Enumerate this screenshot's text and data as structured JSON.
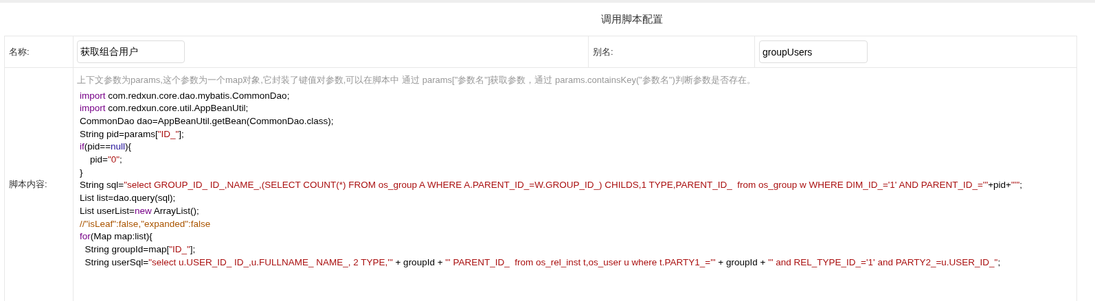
{
  "title": "调用脚本配置",
  "name_label": "名称:",
  "name_value": "获取组合用户",
  "alias_label": "别名:",
  "alias_value": "groupUsers",
  "script_label": "脚本内容:",
  "script_hint": "上下文参数为params,这个参数为一个map对象,它封装了键值对参数,可以在脚本中 通过 params[\"参数名\"]获取参数，通过 params.containsKey(\"参数名\")判断参数是否存在。",
  "code_lines": [
    [
      {
        "kind": "keyword",
        "text": "import"
      },
      {
        "kind": "plain",
        "text": " com.redxun.core.dao.mybatis.CommonDao;"
      }
    ],
    [
      {
        "kind": "keyword",
        "text": "import"
      },
      {
        "kind": "plain",
        "text": " com.redxun.core.util.AppBeanUtil;"
      }
    ],
    [
      {
        "kind": "plain",
        "text": "CommonDao dao=AppBeanUtil.getBean(CommonDao.class);"
      }
    ],
    [
      {
        "kind": "plain",
        "text": "String pid=params["
      },
      {
        "kind": "string",
        "text": "\"ID_\""
      },
      {
        "kind": "plain",
        "text": "];"
      }
    ],
    [
      {
        "kind": "keyword",
        "text": "if"
      },
      {
        "kind": "plain",
        "text": "(pid=="
      },
      {
        "kind": "atom",
        "text": "null"
      },
      {
        "kind": "plain",
        "text": "){"
      }
    ],
    [
      {
        "kind": "plain",
        "text": "    pid="
      },
      {
        "kind": "string",
        "text": "\"0\""
      },
      {
        "kind": "plain",
        "text": ";"
      }
    ],
    [
      {
        "kind": "plain",
        "text": "}"
      }
    ],
    [
      {
        "kind": "plain",
        "text": "String sql="
      },
      {
        "kind": "string",
        "text": "\"select GROUP_ID_ ID_,NAME_,(SELECT COUNT(*) FROM os_group A WHERE A.PARENT_ID_=W.GROUP_ID_) CHILDS,1 TYPE,PARENT_ID_  from os_group w WHERE DIM_ID_='1' AND PARENT_ID_='\""
      },
      {
        "kind": "plain",
        "text": "+pid+"
      },
      {
        "kind": "string",
        "text": "\"'\""
      },
      {
        "kind": "plain",
        "text": ";"
      }
    ],
    [
      {
        "kind": "plain",
        "text": "List list=dao.query(sql);"
      }
    ],
    [
      {
        "kind": "plain",
        "text": "List userList="
      },
      {
        "kind": "keyword",
        "text": "new"
      },
      {
        "kind": "plain",
        "text": " ArrayList();"
      }
    ],
    [
      {
        "kind": "comment",
        "text": "//\"isLeaf\":false,\"expanded\":false"
      }
    ],
    [
      {
        "kind": "keyword",
        "text": "for"
      },
      {
        "kind": "plain",
        "text": "(Map map:list){"
      }
    ],
    [
      {
        "kind": "plain",
        "text": "  String groupId=map["
      },
      {
        "kind": "string",
        "text": "\"ID_\""
      },
      {
        "kind": "plain",
        "text": "];"
      }
    ],
    [
      {
        "kind": "plain",
        "text": "  String userSql="
      },
      {
        "kind": "string",
        "text": "\"select u.USER_ID_ ID_,u.FULLNAME_ NAME_, 2 TYPE,'\""
      },
      {
        "kind": "plain",
        "text": " + groupId + "
      },
      {
        "kind": "string",
        "text": "\"' PARENT_ID_  from os_rel_inst t,os_user u where t.PARTY1_='\""
      },
      {
        "kind": "plain",
        "text": " + groupId + "
      },
      {
        "kind": "string",
        "text": "\"' and REL_TYPE_ID_='1' and PARTY2_=u.USER_ID_\""
      },
      {
        "kind": "plain",
        "text": ";"
      }
    ]
  ]
}
